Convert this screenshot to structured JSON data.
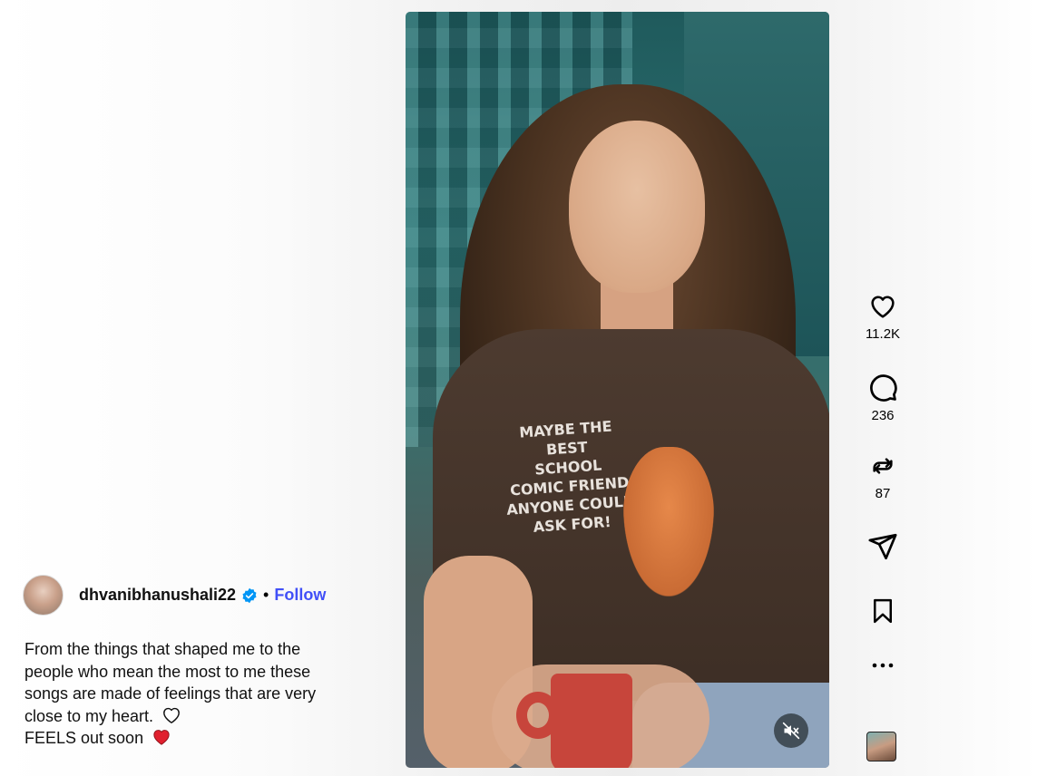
{
  "post": {
    "author": {
      "username": "dhvanibhanushali22",
      "verified": true,
      "separator": "•",
      "follow_label": "Follow"
    },
    "caption_lines": [
      "From the things that shaped me to the",
      "people who mean the most to me these",
      "songs are made of feelings that are very",
      "close to my heart.",
      "FEELS out soon"
    ]
  },
  "video": {
    "shirt_text_lines": [
      "MAYBE THE",
      "BEST",
      "SCHOOL",
      "COMIC FRIEND",
      "ANYONE COULD",
      "ASK FOR!"
    ],
    "muted": true
  },
  "actions": {
    "likes": "11.2K",
    "comments": "236",
    "reposts": "87"
  },
  "icons": {
    "like": "heart-outline-icon",
    "comment": "comment-bubble-icon",
    "repost": "repost-icon",
    "share": "paper-plane-icon",
    "save": "bookmark-icon",
    "more": "more-dots-icon",
    "mute": "speaker-muted-icon",
    "verified": "verified-badge-icon",
    "white_heart": "white-heart-icon",
    "red_heart": "red-heart-icon"
  },
  "colors": {
    "follow": "#4150f7",
    "verified": "#0095f6",
    "red_heart": "#e0202e"
  }
}
